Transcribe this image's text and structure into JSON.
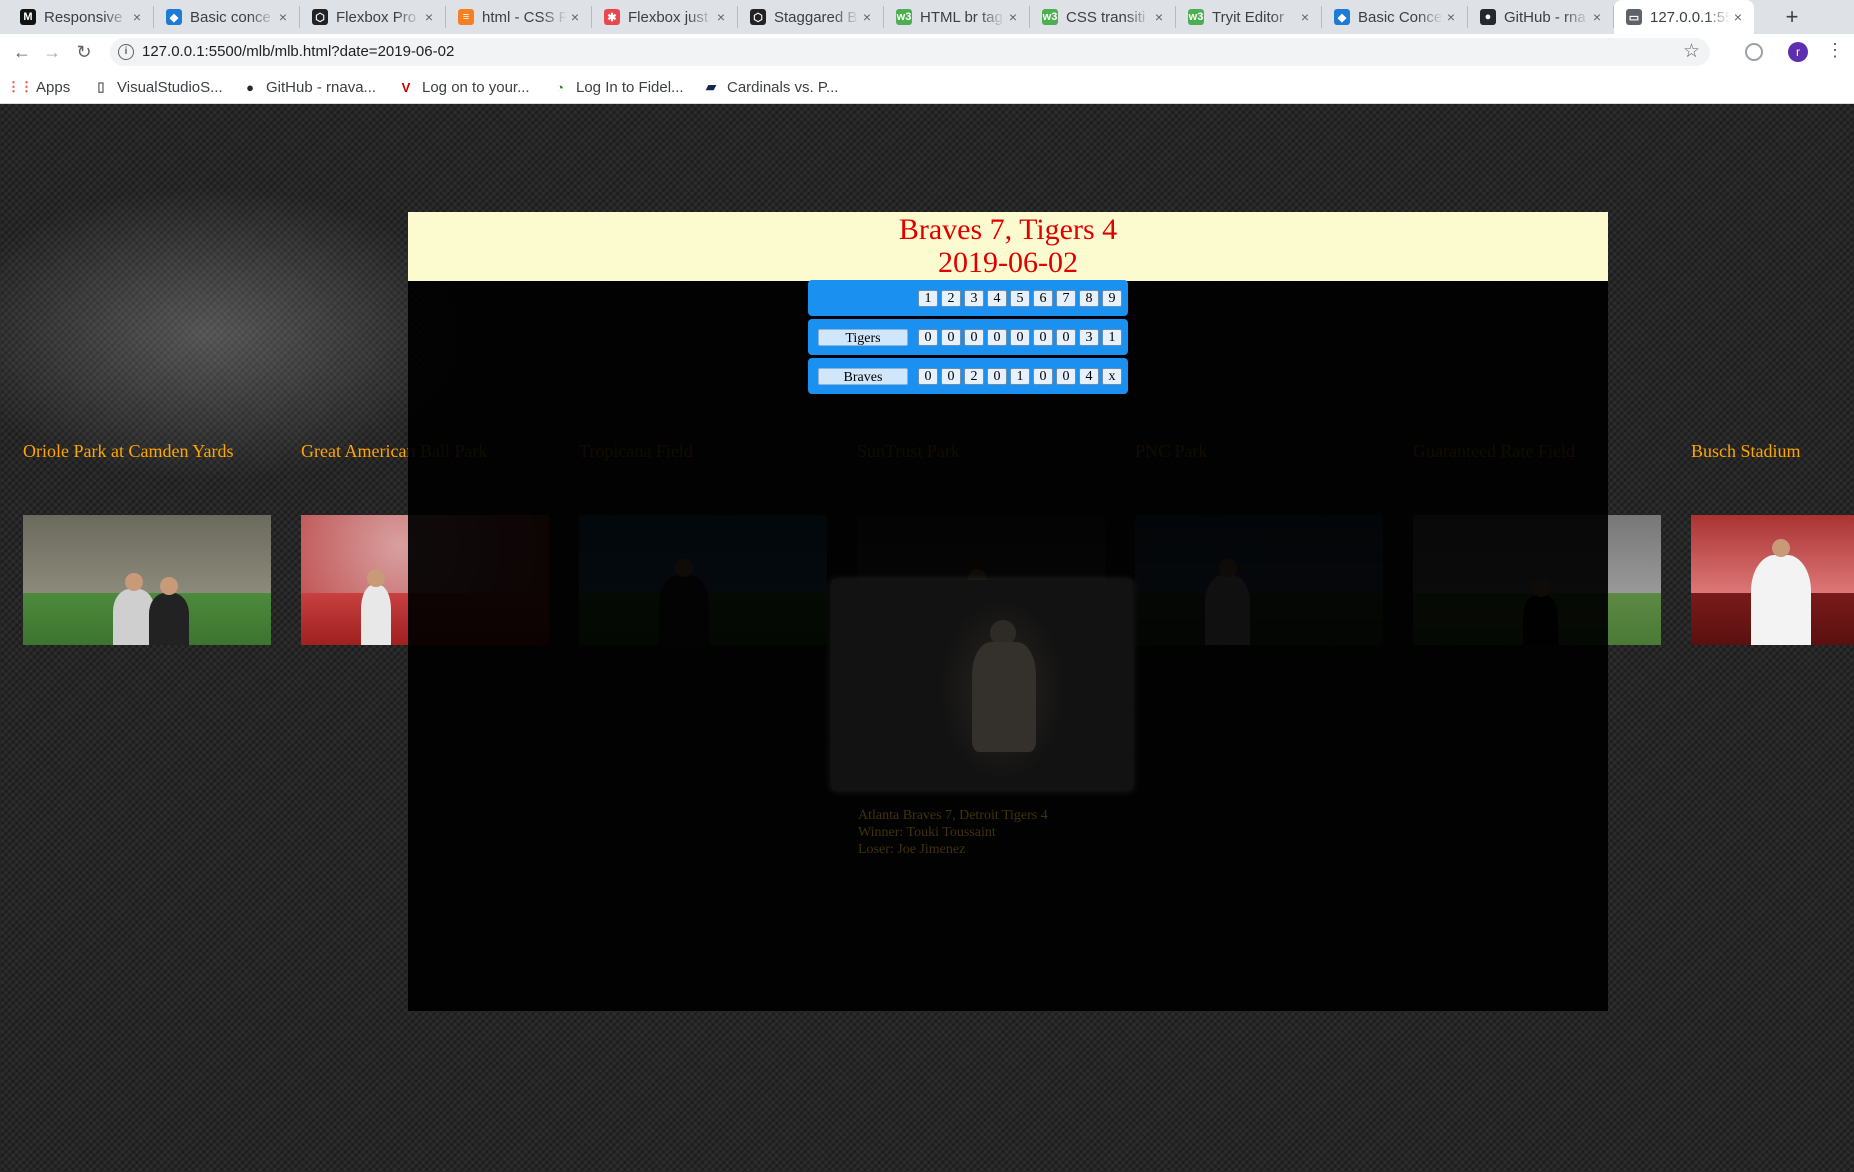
{
  "browser": {
    "tabs": [
      {
        "title": "Responsive",
        "icon": "gmail-icon",
        "color": "#111111",
        "glyph": "M"
      },
      {
        "title": "Basic conce",
        "icon": "mdn-icon",
        "color": "#1c7bd4",
        "glyph": "◆"
      },
      {
        "title": "Flexbox Pro",
        "icon": "codepen-icon",
        "color": "#222222",
        "glyph": "⬡"
      },
      {
        "title": "html - CSS Fl",
        "icon": "stackoverflow-icon",
        "color": "#f48024",
        "glyph": "≡"
      },
      {
        "title": "Flexbox just",
        "icon": "csstricks-icon",
        "color": "#e8474c",
        "glyph": "✱"
      },
      {
        "title": "Staggared B",
        "icon": "codepen-icon",
        "color": "#222222",
        "glyph": "⬡"
      },
      {
        "title": "HTML br tag",
        "icon": "w3schools-icon",
        "color": "#4caf50",
        "glyph": "w3"
      },
      {
        "title": "CSS transiti",
        "icon": "w3schools-icon",
        "color": "#4caf50",
        "glyph": "w3"
      },
      {
        "title": "Tryit Editor",
        "icon": "w3schools-icon",
        "color": "#4caf50",
        "glyph": "w3"
      },
      {
        "title": "Basic Conce",
        "icon": "mdn-icon",
        "color": "#1c7bd4",
        "glyph": "◆"
      },
      {
        "title": "GitHub - rna",
        "icon": "github-icon",
        "color": "#24292e",
        "glyph": "●"
      },
      {
        "title": "127.0.0.1:55",
        "icon": "page-icon",
        "color": "#5f6368",
        "glyph": "▭"
      }
    ],
    "url": "127.0.0.1:5500/mlb/mlb.html?date=2019-06-02",
    "bookmarks": [
      {
        "label": "Apps",
        "icon": "apps-grid-icon"
      },
      {
        "label": "VisualStudioS...",
        "icon": "page-icon"
      },
      {
        "label": "GitHub - rnava...",
        "icon": "github-icon"
      },
      {
        "label": "Log on to your...",
        "icon": "v-icon"
      },
      {
        "label": "Log In to Fidel...",
        "icon": "fidelity-icon"
      },
      {
        "label": "Cardinals vs. P...",
        "icon": "mlb-icon"
      }
    ],
    "profile_initial": "r"
  },
  "parks": [
    {
      "name": "Oriole Park at Camden Yards",
      "scene": "camden"
    },
    {
      "name": "Great American Ball Park",
      "scene": "gabp"
    },
    {
      "name": "Tropicana Field",
      "scene": "tropicana"
    },
    {
      "name": "SunTrust Park",
      "scene": "suntrust"
    },
    {
      "name": "PNC Park",
      "scene": "pnc"
    },
    {
      "name": "Guaranteed Rate Field",
      "scene": "grf"
    },
    {
      "name": "Busch Stadium",
      "scene": "busch"
    }
  ],
  "game": {
    "headline": "Braves 7, Tigers 4",
    "date": "2019-06-02",
    "innings": [
      "1",
      "2",
      "3",
      "4",
      "5",
      "6",
      "7",
      "8",
      "9"
    ],
    "linescore": [
      {
        "team": "Tigers",
        "runs": [
          "0",
          "0",
          "0",
          "0",
          "0",
          "0",
          "0",
          "3",
          "1"
        ]
      },
      {
        "team": "Braves",
        "runs": [
          "0",
          "0",
          "2",
          "0",
          "1",
          "0",
          "0",
          "4",
          "x"
        ]
      }
    ],
    "summary": "Atlanta Braves 7, Detroit Tigers 4",
    "winner": "Winner: Touki Toussaint",
    "loser": "Loser: Joe Jimenez"
  }
}
